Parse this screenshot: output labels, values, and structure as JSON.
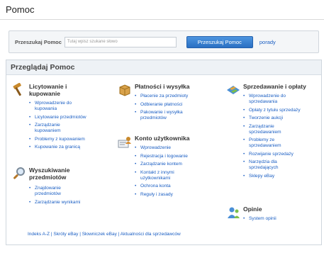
{
  "page": {
    "title": "Pomoc"
  },
  "search": {
    "label": "Przeszukaj Pomoc",
    "placeholder": "Tutaj wpisz szukane słowo",
    "button_label": "Przeszukaj Pomoc",
    "tips_link": "porady"
  },
  "browse": {
    "heading": "Przeglądaj Pomoc",
    "categories": [
      {
        "title_lines": [
          "Licytowanie i",
          "kupowanie"
        ],
        "icon": "gavel-icon",
        "items": [
          {
            "lines": [
              "Wprowadzenie do",
              "kupowania"
            ]
          },
          {
            "lines": [
              "Licytowanie przedmiotów"
            ]
          },
          {
            "lines": [
              "Zarządzanie",
              "kupowaniem"
            ]
          },
          {
            "lines": [
              "Problemy z kupowaniem"
            ]
          },
          {
            "lines": [
              "Kupowanie za granicą"
            ]
          }
        ]
      },
      {
        "title_lines": [
          "Wyszukiwanie",
          "przedmiotów"
        ],
        "icon": "magnifier-icon",
        "items": [
          {
            "lines": [
              "Znajdowanie",
              "przedmiotów"
            ]
          },
          {
            "lines": [
              "Zarządzanie wynikami"
            ]
          }
        ]
      },
      {
        "title_lines": [
          "Płatności i wysyłka"
        ],
        "icon": "package-icon",
        "items": [
          {
            "lines": [
              "Płacenie za przedmioty"
            ]
          },
          {
            "lines": [
              "Odbieranie płatności"
            ]
          },
          {
            "lines": [
              "Pakowanie i wysyłka",
              "przedmiotów"
            ]
          }
        ]
      },
      {
        "title_lines": [
          "Konto użytkownika"
        ],
        "icon": "user-account-icon",
        "items": [
          {
            "lines": [
              "Wprowadzenie"
            ]
          },
          {
            "lines": [
              "Rejestracja i logowanie"
            ]
          },
          {
            "lines": [
              "Zarządzanie kontem"
            ]
          },
          {
            "lines": [
              "Kontakt z innymi",
              "użytkownikami"
            ]
          },
          {
            "lines": [
              "Ochrona konta"
            ]
          },
          {
            "lines": [
              "Reguły i zasady"
            ]
          }
        ]
      },
      {
        "title_lines": [
          "Sprzedawanie i opłaty"
        ],
        "icon": "selling-icon",
        "items": [
          {
            "lines": [
              "Wprowadzenie do",
              "sprzedawania"
            ]
          },
          {
            "lines": [
              "Opłaty z tytułu sprzedaży"
            ]
          },
          {
            "lines": [
              "Tworzenie aukcji"
            ]
          },
          {
            "lines": [
              "Zarządzanie",
              "sprzedawaniem"
            ]
          },
          {
            "lines": [
              "Problemy ze",
              "sprzedawaniem"
            ]
          },
          {
            "lines": [
              "Rozwijanie sprzedaży"
            ]
          },
          {
            "lines": [
              "Narzędzia dla",
              "sprzedających"
            ]
          },
          {
            "lines": [
              "Sklepy eBay"
            ]
          }
        ]
      },
      {
        "title_lines": [
          "Opinie"
        ],
        "icon": "feedback-icon",
        "items": [
          {
            "lines": [
              "System opinii"
            ]
          }
        ]
      }
    ]
  },
  "footer": {
    "text": "Indeks A-Z | Skróty eBay | Słowniczek eBay | Aktualności dla sprzedawców"
  }
}
